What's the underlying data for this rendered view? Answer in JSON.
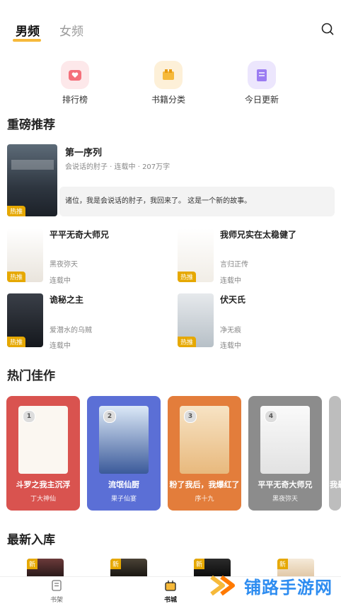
{
  "tabs": {
    "active": "男频",
    "inactive": "女频"
  },
  "quick_actions": [
    {
      "label": "排行榜",
      "icon": "heart-badge-icon",
      "color": "#f4707b",
      "bg": "#fde8ea"
    },
    {
      "label": "书籍分类",
      "icon": "folder-icon",
      "color": "#f6b93a",
      "bg": "#fdf0d8"
    },
    {
      "label": "今日更新",
      "icon": "book-icon",
      "color": "#9b7cf2",
      "bg": "#ece6fd"
    }
  ],
  "sections": {
    "recommend": "重磅推荐",
    "hot": "热门佳作",
    "latest": "最新入库"
  },
  "featured": {
    "title": "第一序列",
    "meta": "会说话的肘子 · 连载中 · 207万字",
    "desc": "诸位，我是会说话的肘子，我回来了。 这是一个新的故事。",
    "tag": "热推"
  },
  "books": [
    {
      "title": "平平无奇大师兄",
      "author": "黑夜弥天",
      "status": "连载中",
      "tag": "热推"
    },
    {
      "title": "我师兄实在太稳健了",
      "author": "言归正传",
      "status": "连载中",
      "tag": "热推"
    },
    {
      "title": "诡秘之主",
      "author": "爱潜水的乌贼",
      "status": "连载中",
      "tag": "热推"
    },
    {
      "title": "伏天氏",
      "author": "净无痕",
      "status": "连载中",
      "tag": "热推"
    }
  ],
  "hot": [
    {
      "rank": "1",
      "title": "斗罗之我主沉浮",
      "author": "丁大神仙",
      "color": "#d9534f"
    },
    {
      "rank": "2",
      "title": "流氓仙厨",
      "author": "果子仙宴",
      "color": "#5b6fd6"
    },
    {
      "rank": "3",
      "title": "粉了我后，我爆红了",
      "author": "序十九",
      "color": "#e37d3b"
    },
    {
      "rank": "4",
      "title": "平平无奇大师兄",
      "author": "黑夜弥天",
      "color": "#8c8c8c"
    },
    {
      "rank": "",
      "title": "我最",
      "author": "",
      "color": "#bdbdbd"
    }
  ],
  "latest_tag": "新",
  "bottom_nav": {
    "shelf": "书架",
    "store": "书城"
  },
  "watermark": "铺路手游网"
}
